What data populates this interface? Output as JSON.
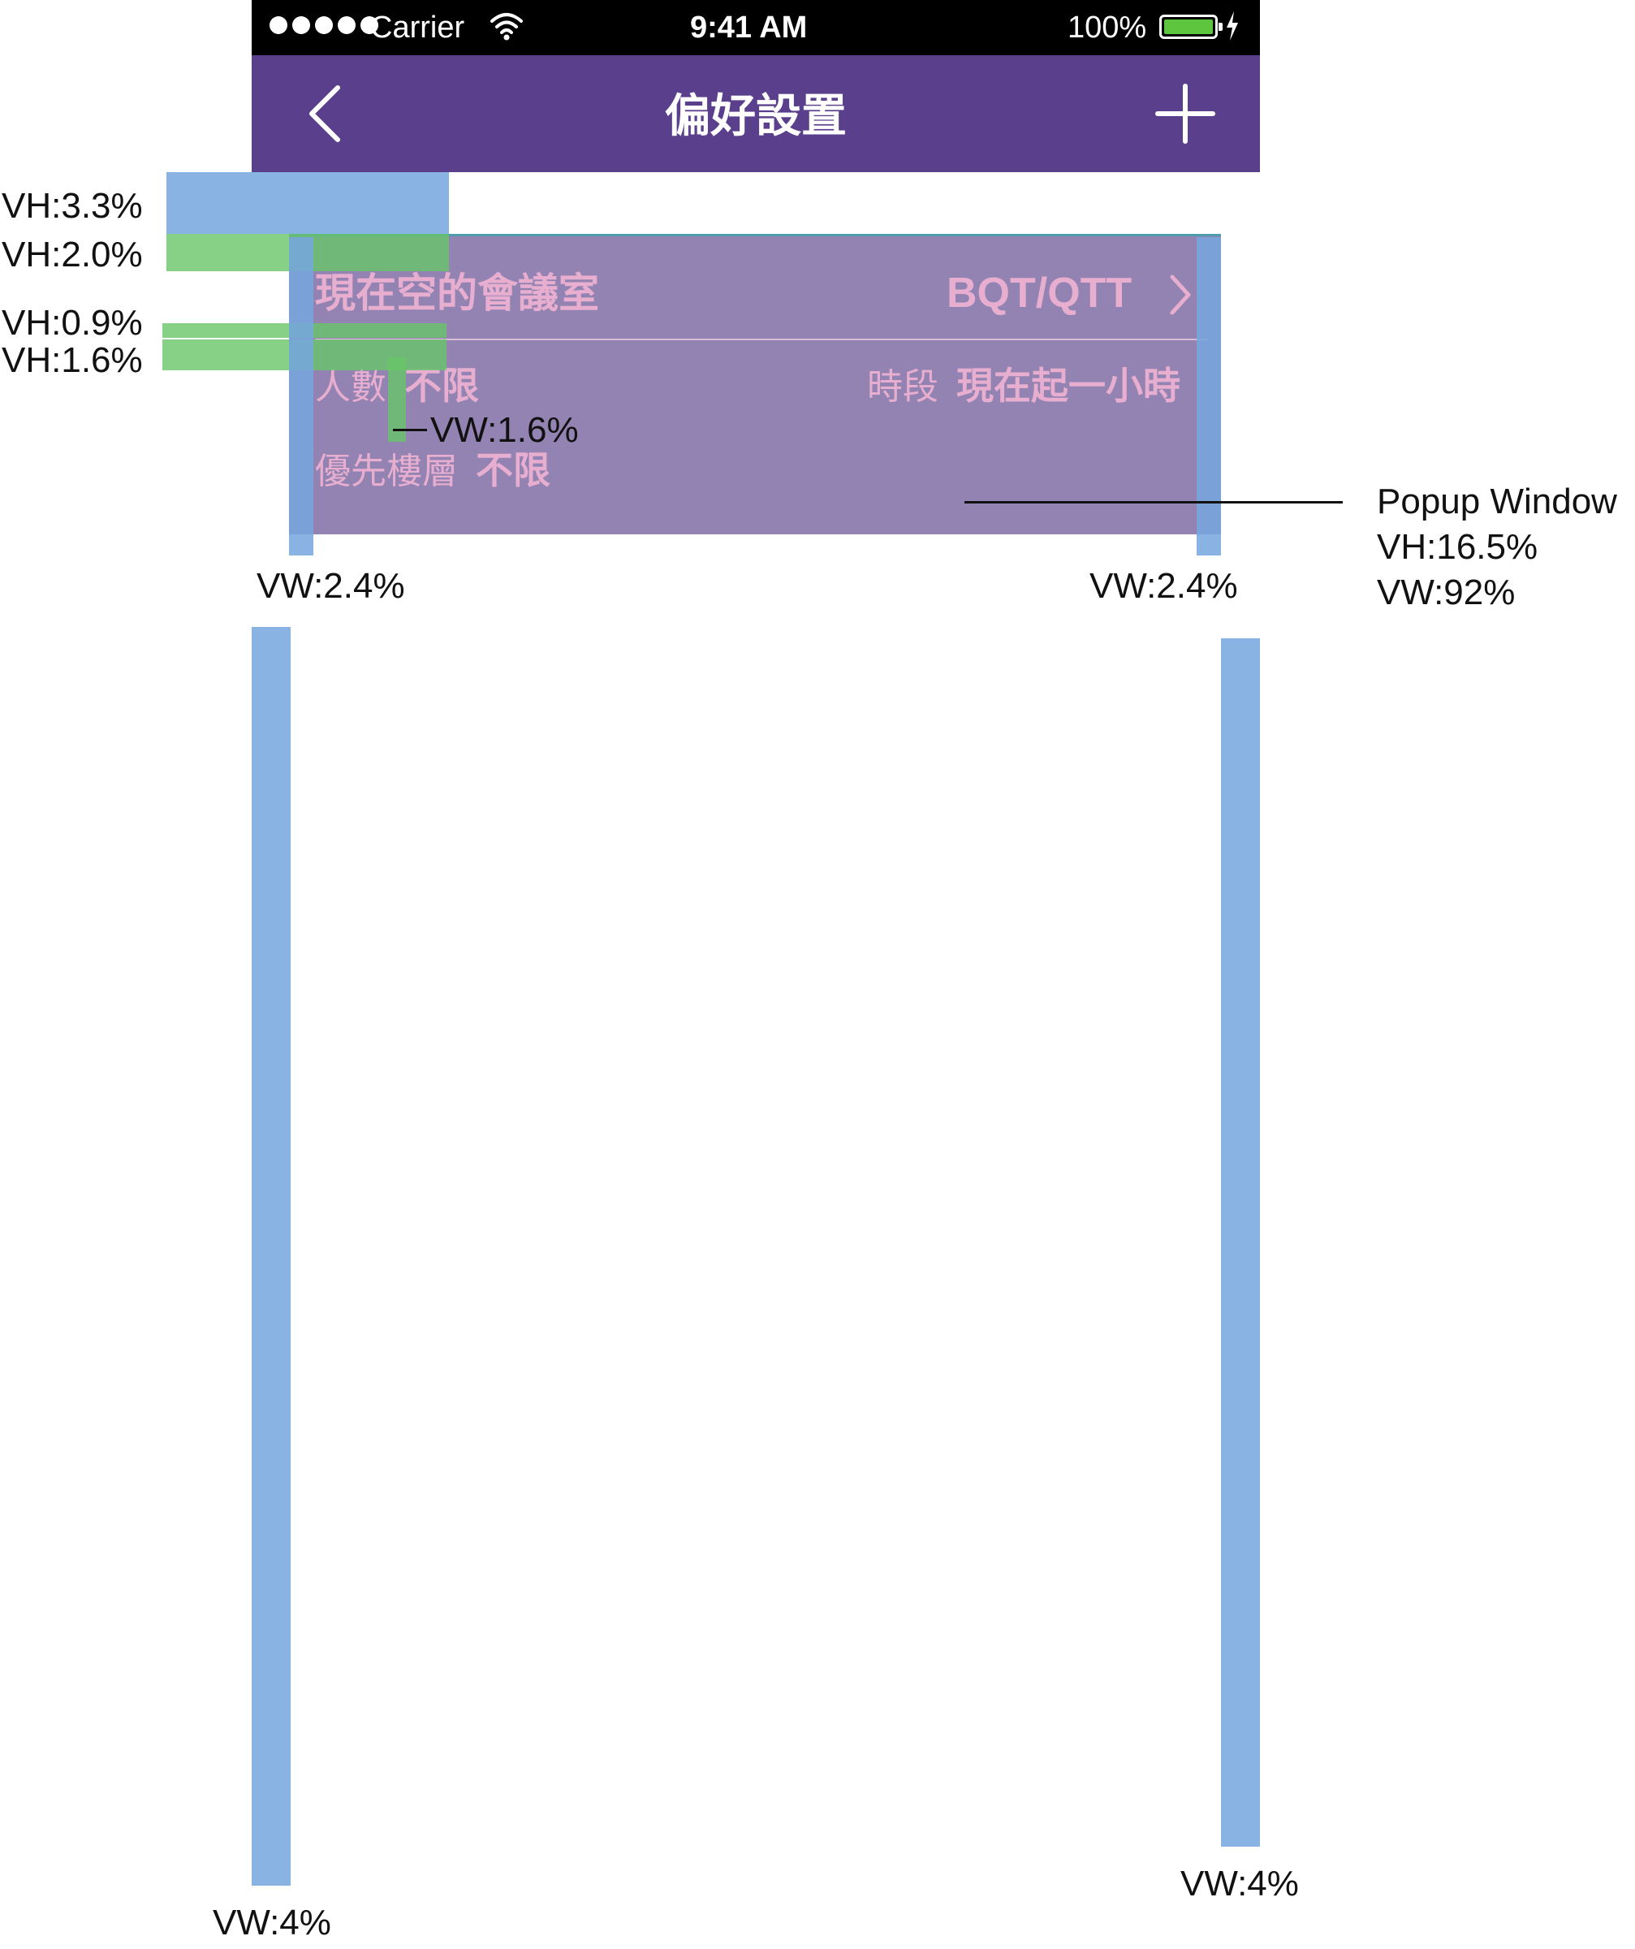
{
  "status_bar": {
    "carrier": "Carrier",
    "time": "9:41 AM",
    "battery": "100%",
    "battery_color": "#5ec53f",
    "icons": [
      "signal-dots-icon",
      "wifi-icon",
      "battery-icon",
      "charging-bolt-icon"
    ]
  },
  "nav_bar": {
    "title": "偏好設置",
    "background": "#5a3f8c",
    "left_icon": "chevron-left-icon",
    "right_icon": "plus-icon"
  },
  "card": {
    "title": "現在空的會議室",
    "location": "BQT/QTT",
    "location_icon": "chevron-right-icon",
    "people_label": "人數",
    "people_value": "不限",
    "period_label": "時段",
    "period_value": "現在起一小時",
    "floor_label": "優先樓層",
    "floor_value": "不限",
    "background": "#9383b2",
    "text_color": "#e7aecf"
  },
  "annotations": {
    "vh_top": "VH:3.3%",
    "vh_title": "VH:2.0%",
    "vh_divider": "VH:0.9%",
    "vh_row": "VH:1.6%",
    "vw_gap": "VW:1.6%",
    "vw_card_left": "VW:2.4%",
    "vw_card_right": "VW:2.4%",
    "popup_name": "Popup Window",
    "popup_vh": "VH:16.5%",
    "popup_vw": "VW:92%",
    "vw_page_left": "VW:4%",
    "vw_page_right": "VW:4%",
    "marker_blue": "#76a7de",
    "marker_green": "#68c568"
  }
}
